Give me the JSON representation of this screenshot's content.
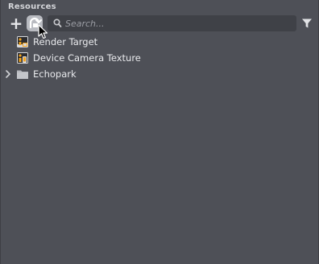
{
  "panel": {
    "title": "Resources"
  },
  "toolbar": {
    "add_label": "+",
    "search": {
      "placeholder": "Search...",
      "value": ""
    }
  },
  "tree": {
    "items": [
      {
        "label": "Render Target",
        "icon": "render-target-icon",
        "expandable": false
      },
      {
        "label": "Device Camera Texture",
        "icon": "device-camera-texture-icon",
        "expandable": false
      },
      {
        "label": "Echopark",
        "icon": "folder-icon",
        "expandable": true
      }
    ]
  },
  "colors": {
    "panel_bg": "#4e5057",
    "search_bg": "#3f4147",
    "text": "#e9eaed",
    "accent_orange": "#f0a020"
  }
}
